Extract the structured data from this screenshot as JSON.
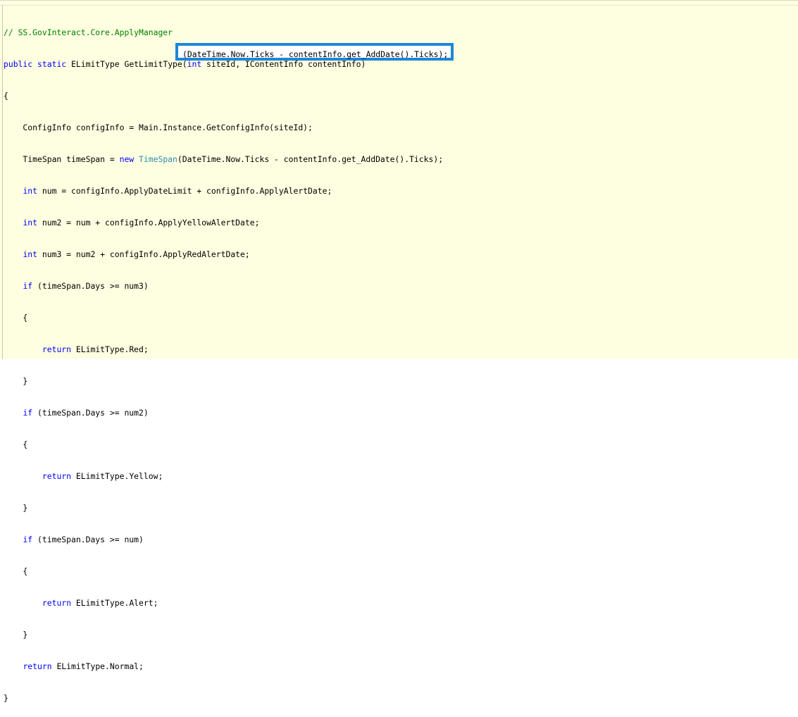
{
  "code": {
    "comment": "// SS.GovInteract.Core.ApplyManager",
    "signature": {
      "kw_public": "public",
      "kw_static": "static",
      "return_type": "ELimitType",
      "method_name": "GetLimitType",
      "open_paren": "(",
      "kw_int": "int",
      "rest": " siteId, IContentInfo contentInfo)"
    },
    "open_brace": "{",
    "lines": {
      "config": "    ConfigInfo configInfo = Main.Instance.GetConfigInfo(siteId);",
      "timespan_prefix": "    TimeSpan timeSpan = ",
      "timespan_new": "new",
      "timespan_type": "TimeSpan",
      "timespan_rest": "(DateTime.Now.Ticks - contentInfo.get_AddDate().Ticks);",
      "num_kw": "int",
      "num_rest": " num = configInfo.ApplyDateLimit + configInfo.ApplyAlertDate;",
      "num2_kw": "int",
      "num2_rest": " num2 = num + configInfo.ApplyYellowAlertDate;",
      "num3_kw": "int",
      "num3_rest": " num3 = num2 + configInfo.ApplyRedAlertDate;",
      "if1_kw": "if",
      "if1_rest": " (timeSpan.Days >= num3)",
      "brace1_open": "    {",
      "ret1_kw": "return",
      "ret1_rest": " ELimitType.Red;",
      "brace1_close": "    }",
      "if2_kw": "if",
      "if2_rest": " (timeSpan.Days >= num2)",
      "brace2_open": "    {",
      "ret2_kw": "return",
      "ret2_rest": " ELimitType.Yellow;",
      "brace2_close": "    }",
      "if3_kw": "if",
      "if3_rest": " (timeSpan.Days >= num)",
      "brace3_open": "    {",
      "ret3_kw": "return",
      "ret3_rest": " ELimitType.Alert;",
      "brace3_close": "    }",
      "ret4_kw": "return",
      "ret4_rest": " ELimitType.Normal;"
    },
    "close_brace": "}"
  },
  "highlight": {
    "text": "(DateTime.Now.Ticks - contentInfo.get_AddDate().Ticks);",
    "border_color": "#1e86d9"
  },
  "colors": {
    "keyword": "#0000ff",
    "type": "#2b91af",
    "comment": "#008000",
    "background": "#fefee0"
  }
}
